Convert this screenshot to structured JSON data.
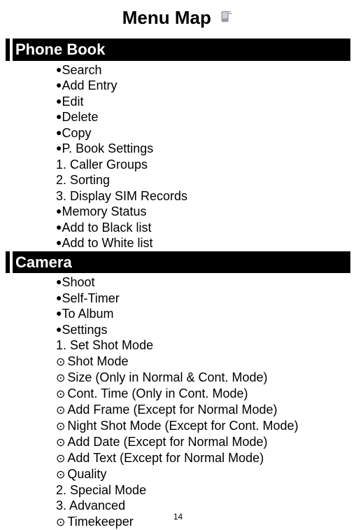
{
  "title": "Menu Map",
  "sections": {
    "phonebook": {
      "header": "Phone Book",
      "items": [
        {
          "b": "solid",
          "t": "Search"
        },
        {
          "b": "solid",
          "t": "Add Entry"
        },
        {
          "b": "solid",
          "t": "Edit"
        },
        {
          "b": "solid",
          "t": "Delete"
        },
        {
          "b": "solid",
          "t": "Copy"
        },
        {
          "b": "solid",
          "t": "P. Book Settings"
        },
        {
          "b": "none",
          "t": "1. Caller Groups"
        },
        {
          "b": "none",
          "t": "2. Sorting"
        },
        {
          "b": "none",
          "t": "3. Display SIM Records"
        },
        {
          "b": "solid",
          "t": "Memory Status"
        },
        {
          "b": "solid",
          "t": "Add to Black list"
        },
        {
          "b": "solid",
          "t": "Add to White list"
        }
      ]
    },
    "camera": {
      "header": "Camera",
      "items": [
        {
          "b": "solid",
          "t": "Shoot"
        },
        {
          "b": "solid",
          "t": "Self-Timer"
        },
        {
          "b": "solid",
          "t": "To Album"
        },
        {
          "b": "solid",
          "t": "Settings"
        },
        {
          "b": "none",
          "t": "1. Set Shot Mode"
        },
        {
          "b": "circle",
          "t": "Shot Mode"
        },
        {
          "b": "circle",
          "t": "Size (Only in Normal & Cont. Mode)"
        },
        {
          "b": "circle",
          "t": "Cont. Time (Only in Cont. Mode)"
        },
        {
          "b": "circle",
          "t": "Add Frame (Except for Normal Mode)"
        },
        {
          "b": "circle",
          "t": "Night Shot Mode (Except for Cont. Mode)"
        },
        {
          "b": "circle",
          "t": "Add Date (Except for Normal Mode)"
        },
        {
          "b": "circle",
          "t": "Add Text (Except for Normal Mode)"
        },
        {
          "b": "circle",
          "t": "Quality"
        },
        {
          "b": "none",
          "t": "2. Special Mode"
        },
        {
          "b": "none",
          "t": "3. Advanced"
        },
        {
          "b": "circle",
          "t": "Timekeeper"
        }
      ]
    }
  },
  "page_number": "14"
}
